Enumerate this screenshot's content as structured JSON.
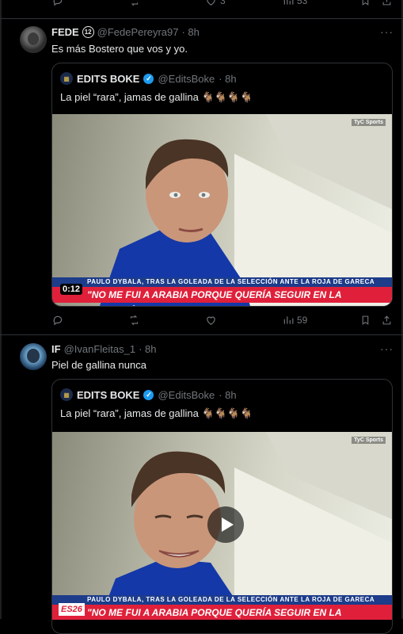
{
  "top_actions": {
    "likes": "3",
    "views": "53"
  },
  "tweets": [
    {
      "name": "FEDE",
      "badge": "12",
      "handle": "@FedePereyra97",
      "time": "· 8h",
      "text": "Es más Bostero que vos y yo.",
      "quote": {
        "name": "EDITS BOKE",
        "handle": "@EditsBoke",
        "time": "· 8h",
        "text": "La piel “rara”, jamas de gallina 🐐🐐🐐🐐",
        "video": {
          "lower_third_top": "PAULO DYBALA, TRAS LA GOLEADA DE LA SELECCIÓN ANTE LA ROJA DE GARECA",
          "lower_third_main": "\"NO ME FUI A ARABIA PORQUE QUERÍA SEGUIR EN LA SELECCIÓN\"",
          "duration": "0:12",
          "network": "TyC Sports"
        }
      },
      "views": "59"
    },
    {
      "name": "IF",
      "handle": "@IvanFleitas_1",
      "time": "· 8h",
      "text": "Piel de gallina nunca",
      "quote": {
        "name": "EDITS BOKE",
        "handle": "@EditsBoke",
        "time": "· 8h",
        "text": "La piel “rara”, jamas de gallina 🐐🐐🐐🐐",
        "video": {
          "lower_third_top": "PAULO DYBALA, TRAS LA GOLEADA DE LA SELECCIÓN ANTE LA ROJA DE GARECA",
          "lower_third_main": "\"NO ME FUI A ARABIA PORQUE QUERÍA SEGUIR EN LA SELECCIÓN\"",
          "network": "TyC Sports",
          "corner_logo": "ES26"
        }
      }
    }
  ],
  "colors": {
    "accent": "#1d9bf0",
    "muted": "#71767b",
    "border": "#2f3336",
    "ticker_red": "#e0203a",
    "ticker_blue": "#1d3c8a"
  }
}
